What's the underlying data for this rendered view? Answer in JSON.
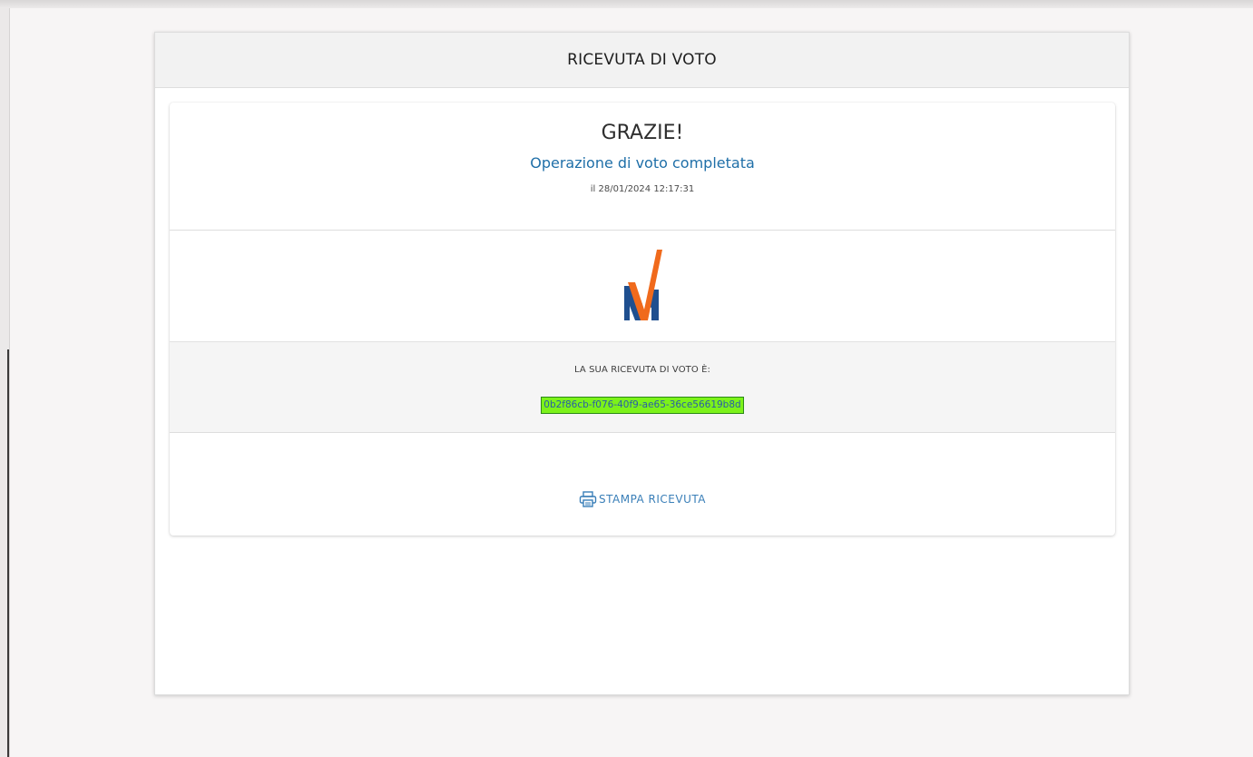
{
  "header": {
    "title": "RICEVUTA DI VOTO"
  },
  "thanks": {
    "title": "GRAZIE!",
    "subtitle": "Operazione di voto completata",
    "date": "il 28/01/2024 12:17:31"
  },
  "logo": {
    "icon": "vote-check-logo",
    "colors": {
      "blue": "#1f4f8f",
      "orange": "#f06a1c"
    }
  },
  "receipt": {
    "label": "LA SUA RICEVUTA DI VOTO È:",
    "code": "0b2f86cb-f076-40f9-ae65-36ce56619b8d",
    "highlight_color": "#7cf21a"
  },
  "actions": {
    "print_label": "STAMPA RICEVUTA",
    "print_icon": "printer-icon",
    "link_color": "#3a7fb8"
  }
}
